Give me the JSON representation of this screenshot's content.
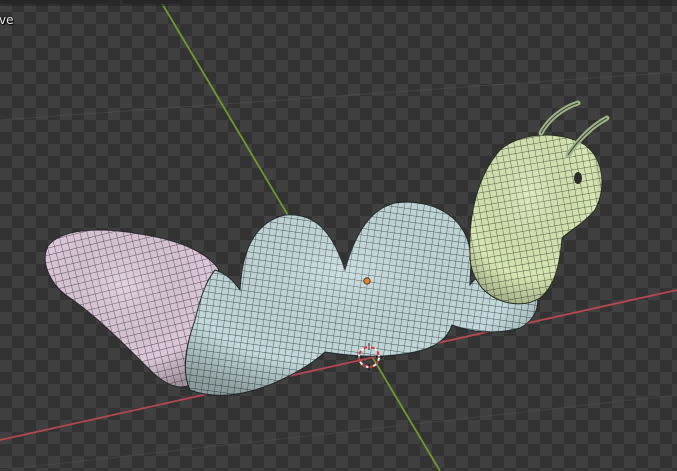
{
  "viewport": {
    "mode_label": "ve",
    "object": "caterpillar-mesh",
    "colors": {
      "checker_dark": "#333333",
      "checker_light": "#404040",
      "x_axis": "#b8474f",
      "y_axis": "#6f9a2e",
      "tail_segment": "#d9c7d6",
      "body_segment": "#c4d9db",
      "head_segment": "#d6e6b3",
      "wire": "#1f2a2d",
      "origin_dot": "#e0852a",
      "cursor_red": "#d23a3a",
      "cursor_white": "#f0f0f0"
    },
    "icons": [
      "3d-cursor-icon",
      "object-origin-icon"
    ]
  }
}
